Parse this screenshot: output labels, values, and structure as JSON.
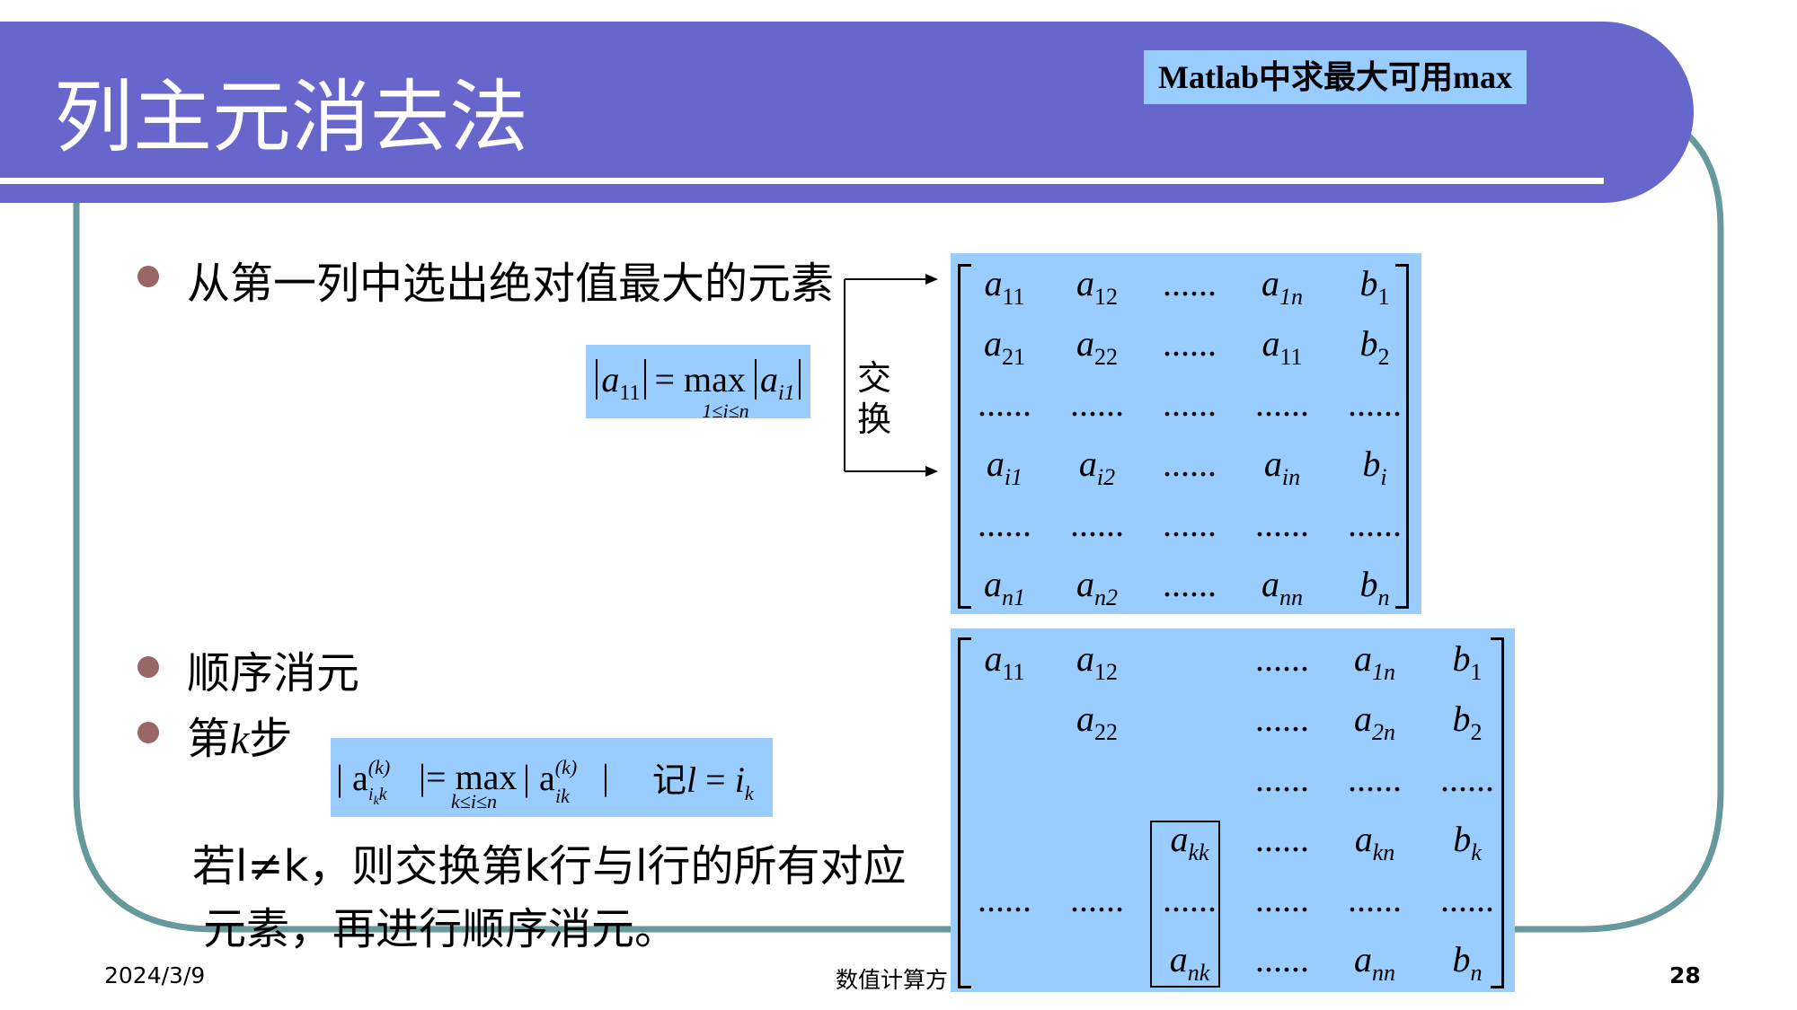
{
  "slide": {
    "title": "列主元消去法",
    "matlab_note": "Matlab中求最大可用max",
    "bullets": [
      "从第一列中选出绝对值最大的元素",
      "顺序消元",
      "第k步"
    ],
    "bullet3_prefix": "第",
    "bullet3_var": "k",
    "bullet3_suffix": "步",
    "exchange_label_1": "交",
    "exchange_label_2": "换",
    "formula1": {
      "lhs_sub": "11",
      "op": "= max",
      "range": "1≤i≤n",
      "rhs_sub": "i1"
    },
    "formula2": {
      "lhs": "| a",
      "lhs_sup": "(k)",
      "lhs_sub": "i",
      "lhs_sub2": "k",
      "lhs_sub3": "k",
      "op": "|= max",
      "rhs": "| a",
      "rhs_sup": "(k)",
      "rhs_sub": "ik",
      "rhs_end": "|",
      "range": "k≤i≤n",
      "note_prefix": "记",
      "note_var": "l",
      "note_eq": " = ",
      "note_rhs": "i",
      "note_rhs_sub": "k"
    },
    "bottom_line1": "若l≠k，则交换第k行与l行的所有对应",
    "bottom_line2": "元素，再进行顺序消元。",
    "footer": {
      "date": "2024/3/9",
      "center": "数值计算方",
      "page": "28"
    }
  },
  "matrix1": [
    [
      {
        "v": "a",
        "s": "11"
      },
      {
        "v": "a",
        "s": "12"
      },
      {
        "v": "......",
        "s": ""
      },
      {
        "v": "a",
        "s": "1n"
      },
      {
        "v": "b",
        "s": "1"
      }
    ],
    [
      {
        "v": "a",
        "s": "21"
      },
      {
        "v": "a",
        "s": "22"
      },
      {
        "v": "......",
        "s": ""
      },
      {
        "v": "a",
        "s": "11"
      },
      {
        "v": "b",
        "s": "2"
      }
    ],
    [
      {
        "v": "......",
        "s": ""
      },
      {
        "v": "......",
        "s": ""
      },
      {
        "v": "......",
        "s": ""
      },
      {
        "v": "......",
        "s": ""
      },
      {
        "v": "......",
        "s": ""
      }
    ],
    [
      {
        "v": "a",
        "s": "i1"
      },
      {
        "v": "a",
        "s": "i2"
      },
      {
        "v": "......",
        "s": ""
      },
      {
        "v": "a",
        "s": "in"
      },
      {
        "v": "b",
        "s": "i"
      }
    ],
    [
      {
        "v": "......",
        "s": ""
      },
      {
        "v": "......",
        "s": ""
      },
      {
        "v": "......",
        "s": ""
      },
      {
        "v": "......",
        "s": ""
      },
      {
        "v": "......",
        "s": ""
      }
    ],
    [
      {
        "v": "a",
        "s": "n1"
      },
      {
        "v": "a",
        "s": "n2"
      },
      {
        "v": "......",
        "s": ""
      },
      {
        "v": "a",
        "s": "nn"
      },
      {
        "v": "b",
        "s": "n"
      }
    ]
  ],
  "matrix2": [
    [
      {
        "v": "a",
        "s": "11"
      },
      {
        "v": "a",
        "s": "12"
      },
      {
        "v": "",
        "s": ""
      },
      {
        "v": "......",
        "s": ""
      },
      {
        "v": "a",
        "s": "1n"
      },
      {
        "v": "b",
        "s": "1"
      }
    ],
    [
      {
        "v": "",
        "s": ""
      },
      {
        "v": "a",
        "s": "22"
      },
      {
        "v": "",
        "s": ""
      },
      {
        "v": "......",
        "s": ""
      },
      {
        "v": "a",
        "s": "2n"
      },
      {
        "v": "b",
        "s": "2"
      }
    ],
    [
      {
        "v": "",
        "s": ""
      },
      {
        "v": "",
        "s": ""
      },
      {
        "v": "",
        "s": ""
      },
      {
        "v": "......",
        "s": ""
      },
      {
        "v": "......",
        "s": ""
      },
      {
        "v": "......",
        "s": ""
      }
    ],
    [
      {
        "v": "",
        "s": ""
      },
      {
        "v": "",
        "s": ""
      },
      {
        "v": "a",
        "s": "kk"
      },
      {
        "v": "......",
        "s": ""
      },
      {
        "v": "a",
        "s": "kn"
      },
      {
        "v": "b",
        "s": "k"
      }
    ],
    [
      {
        "v": "......",
        "s": ""
      },
      {
        "v": "......",
        "s": ""
      },
      {
        "v": "......",
        "s": ""
      },
      {
        "v": "......",
        "s": ""
      },
      {
        "v": "......",
        "s": ""
      },
      {
        "v": "......",
        "s": ""
      }
    ],
    [
      {
        "v": "",
        "s": ""
      },
      {
        "v": "",
        "s": ""
      },
      {
        "v": "a",
        "s": "nk"
      },
      {
        "v": "......",
        "s": ""
      },
      {
        "v": "a",
        "s": "nn"
      },
      {
        "v": "b",
        "s": "n"
      }
    ]
  ],
  "colors": {
    "title_bar": "#6666cc",
    "highlight": "#99ccff",
    "frame": "#669999",
    "bullet": "#996666"
  }
}
